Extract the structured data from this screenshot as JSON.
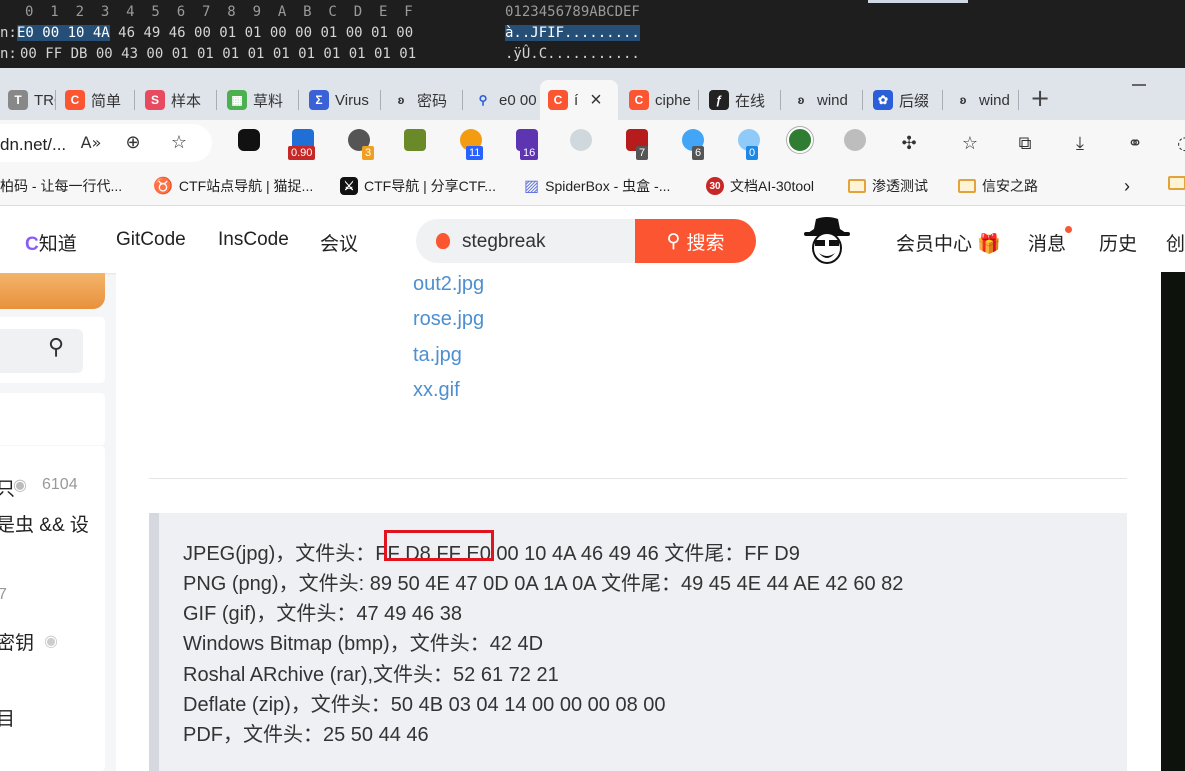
{
  "hex_editor": {
    "header_cols": "0  1  2  3  4  5  6  7  8  9  A  B  C  D  E  F",
    "header_ascii": "0123456789ABCDEF",
    "row1_label": "n:",
    "row1_bytes_selected": "E0 00 10 4A",
    "row1_bytes": "46 49 46 00 01 01 00 00 01 00 01 00",
    "row1_ascii_selected": "à..J",
    "row1_ascii": "FIF.........",
    "row2_label": "n:",
    "row2_bytes": "00 FF DB 00 43 00 01 01 01 01 01 01 01 01 01 01",
    "row2_ascii": ".ÿÛ.C..........."
  },
  "tabs": [
    {
      "label": "TRON",
      "icon": "tron-icon"
    },
    {
      "label": "简单",
      "icon": "csdn-icon"
    },
    {
      "label": "样本",
      "icon": "sample-icon"
    },
    {
      "label": "草料",
      "icon": "qr-icon"
    },
    {
      "label": "Virus",
      "icon": "virustotal-icon"
    },
    {
      "label": "密码",
      "icon": "crypto-icon"
    },
    {
      "label": "e0 00",
      "icon": "search-icon"
    },
    {
      "label": "í",
      "icon": "csdn-icon",
      "active": true,
      "close": "×"
    },
    {
      "label": "ciphe",
      "icon": "csdn-icon"
    },
    {
      "label": "在线",
      "icon": "online-icon"
    },
    {
      "label": "wind",
      "icon": "crypto-icon"
    },
    {
      "label": "后缀",
      "icon": "baidu-icon"
    },
    {
      "label": "wind",
      "icon": "crypto-icon"
    }
  ],
  "new_tab": "+",
  "address": {
    "url": "dn.net/..."
  },
  "ext_badges": {
    "e1": "0.90",
    "e2": "3",
    "e3": "11",
    "e4": "16",
    "e5": "7",
    "e6": "6",
    "e7": "0"
  },
  "bookmarks": [
    {
      "label": "柏码 - 让每一行代..."
    },
    {
      "label": "CTF站点导航 | 猫捉..."
    },
    {
      "label": "CTF导航 | 分享CTF..."
    },
    {
      "label": "SpiderBox - 虫盒 -..."
    },
    {
      "label": "文档AI-30tool"
    },
    {
      "label": "渗透测试"
    },
    {
      "label": "信安之路"
    }
  ],
  "nav": {
    "zhidao": "知道",
    "gitcode": "GitCode",
    "inscode": "InsCode",
    "meeting": "会议",
    "search_query": "stegbreak",
    "search_button": "搜索",
    "vip": "会员中心",
    "messages": "消息",
    "history": "历史",
    "create": "创"
  },
  "sidebar": {
    "item1_text": "只",
    "item1_views": "6104",
    "item2_text": "是虫 && 设",
    "item3_num": "7",
    "item4_text": "密钥",
    "item5_text": "目"
  },
  "article": {
    "links": [
      "out2.jpg",
      "rose.jpg",
      "ta.jpg",
      "xx.gif"
    ],
    "quote_lines": [
      "JPEG(jpg)，文件头：FF D8 FF E0 00 10 4A 46 49 46 文件尾：FF D9",
      "PNG (png)，文件头: 89 50 4E 47 0D 0A 1A 0A 文件尾：49 45 4E 44 AE 42 60 82",
      "GIF (gif)，文件头：47 49 46 38",
      "Windows Bitmap (bmp)，文件头：42 4D",
      "Roshal ARchive (rar),文件头：52 61 72 21",
      "Deflate (zip)，文件头：50 4B 03 04 14 00 00 00 08 00",
      "PDF，文件头：25 50 44 46"
    ]
  },
  "colors": {
    "csdn_red": "#fc5531",
    "link_blue": "#4d8fd1",
    "highlight_box": "#e0141e",
    "hex_selection": "#264f78"
  }
}
